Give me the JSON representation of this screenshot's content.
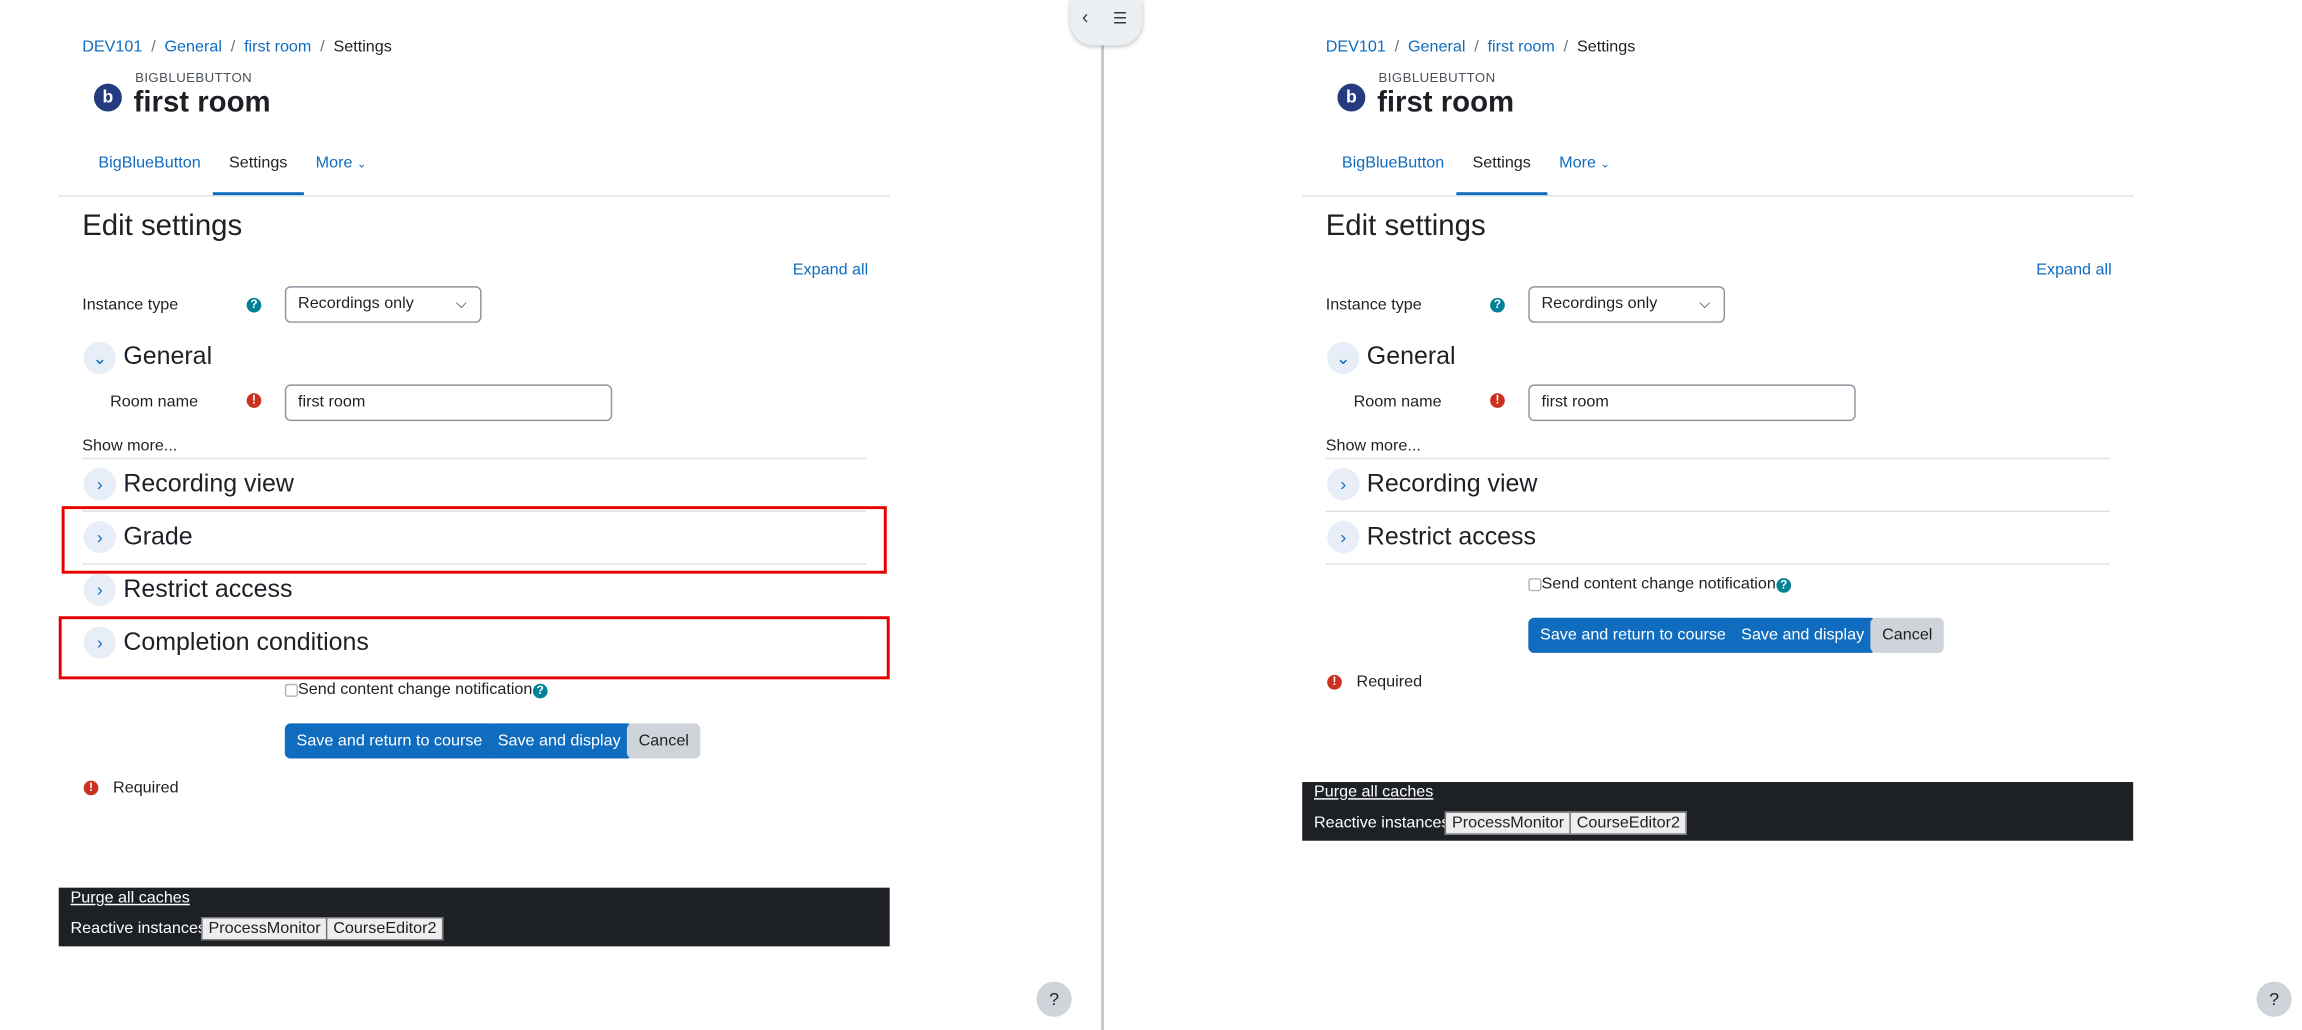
{
  "breadcrumb": [
    "DEV101",
    "General",
    "first room",
    "Settings"
  ],
  "activity": {
    "module_type": "BIGBLUEBUTTON",
    "title": "first room",
    "logo_icon": "bigbluebutton-logo-icon"
  },
  "tabs": {
    "items": [
      "BigBlueButton",
      "Settings",
      "More"
    ],
    "active": "Settings"
  },
  "form": {
    "heading": "Edit settings",
    "expand_all": "Expand all",
    "instance_type_label": "Instance type",
    "instance_type_value": "Recordings only",
    "room_name_label": "Room name",
    "room_name_value": "first room",
    "show_more": "Show more...",
    "sections": {
      "general": "General",
      "recording_view": "Recording view",
      "grade": "Grade",
      "restrict_access": "Restrict access",
      "completion_conditions": "Completion conditions"
    },
    "notify_label": "Send content change notification",
    "buttons": {
      "save_return": "Save and return to course",
      "save_display": "Save and display",
      "cancel": "Cancel"
    },
    "required_label": "Required"
  },
  "footer": {
    "purge": "Purge all caches",
    "reactive_label": "Reactive instances:",
    "instances": [
      "ProcessMonitor",
      "CourseEditor2"
    ]
  },
  "drawer": {
    "collapse_icon": "‹",
    "index_icon": "☰"
  },
  "help": {
    "label": "?"
  },
  "colors": {
    "link": "#0f6cbf",
    "primary": "#0f6cbf",
    "highlight": "#e60000",
    "footer_bg": "#1d2125",
    "help_icon": "#008196",
    "required_icon": "#ca3120"
  }
}
